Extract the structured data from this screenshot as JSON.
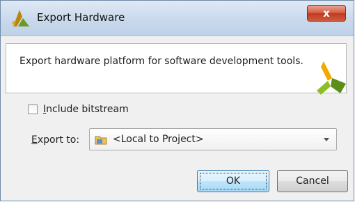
{
  "window": {
    "title": "Export Hardware",
    "close_symbol": "x"
  },
  "header": {
    "description": "Export hardware platform for software development tools.",
    "logo_icon": "vivado-logo-icon"
  },
  "options": {
    "include_bitstream": {
      "label_first": "I",
      "label_rest": "nclude bitstream",
      "checked": false
    },
    "export_to": {
      "label_first": "E",
      "label_rest": "xport to:",
      "value": "<Local to Project>",
      "icon": "folder-icon"
    }
  },
  "buttons": {
    "ok_label": "OK",
    "cancel_label": "Cancel"
  },
  "colors": {
    "title_bar": "#c9d9ec",
    "close_button": "#c03a22",
    "dialog_bg": "#f0f0f0",
    "ok_accent": "#3c7fb1"
  }
}
